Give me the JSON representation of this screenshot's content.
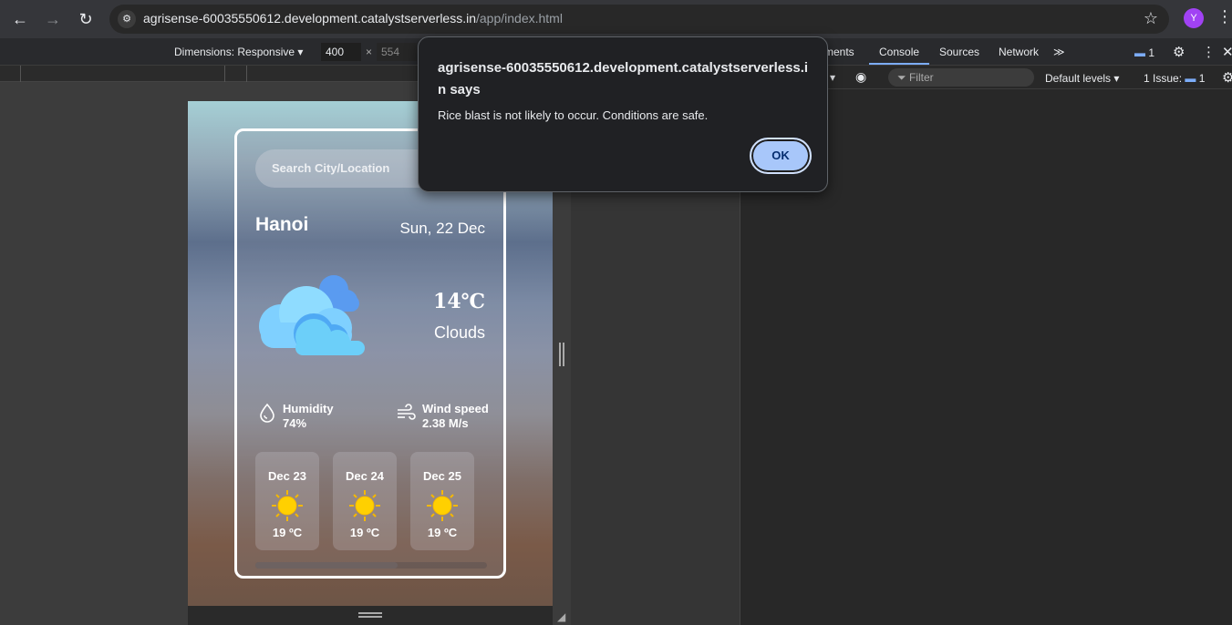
{
  "browser": {
    "url_host": "agrisense-60035550612.development.catalystserverless.in",
    "url_path": "/app/index.html",
    "profile_initial": "Y"
  },
  "device_toolbar": {
    "dimensions_label": "Dimensions: Responsive",
    "width_value": "400",
    "times": "×",
    "height_placeholder": "554"
  },
  "devtools": {
    "tabs": [
      "ments",
      "Console",
      "Sources",
      "Network"
    ],
    "more_tabs": "≫",
    "issue_count_top": "1",
    "filter_placeholder": "Filter",
    "default_levels": "Default levels ▾",
    "issues_label": "1 Issue:",
    "issues_count": "1"
  },
  "weather_app": {
    "search_placeholder": "Search City/Location",
    "city": "Hanoi",
    "date": "Sun, 22 Dec",
    "temperature": "14℃",
    "condition": "Clouds",
    "humidity_label": "Humidity",
    "humidity_value": "74%",
    "wind_label": "Wind speed",
    "wind_value": "2.38 M/s",
    "forecast": [
      {
        "date": "Dec 23",
        "temp": "19 ºC",
        "icon": "sun-icon"
      },
      {
        "date": "Dec 24",
        "temp": "19 ºC",
        "icon": "sun-icon"
      },
      {
        "date": "Dec 25",
        "temp": "19 ºC",
        "icon": "sun-icon"
      }
    ]
  },
  "alert": {
    "title": "agrisense-60035550612.development.catalystserverless.in says",
    "message": "Rice blast is not likely to occur. Conditions are safe.",
    "ok_label": "OK"
  }
}
